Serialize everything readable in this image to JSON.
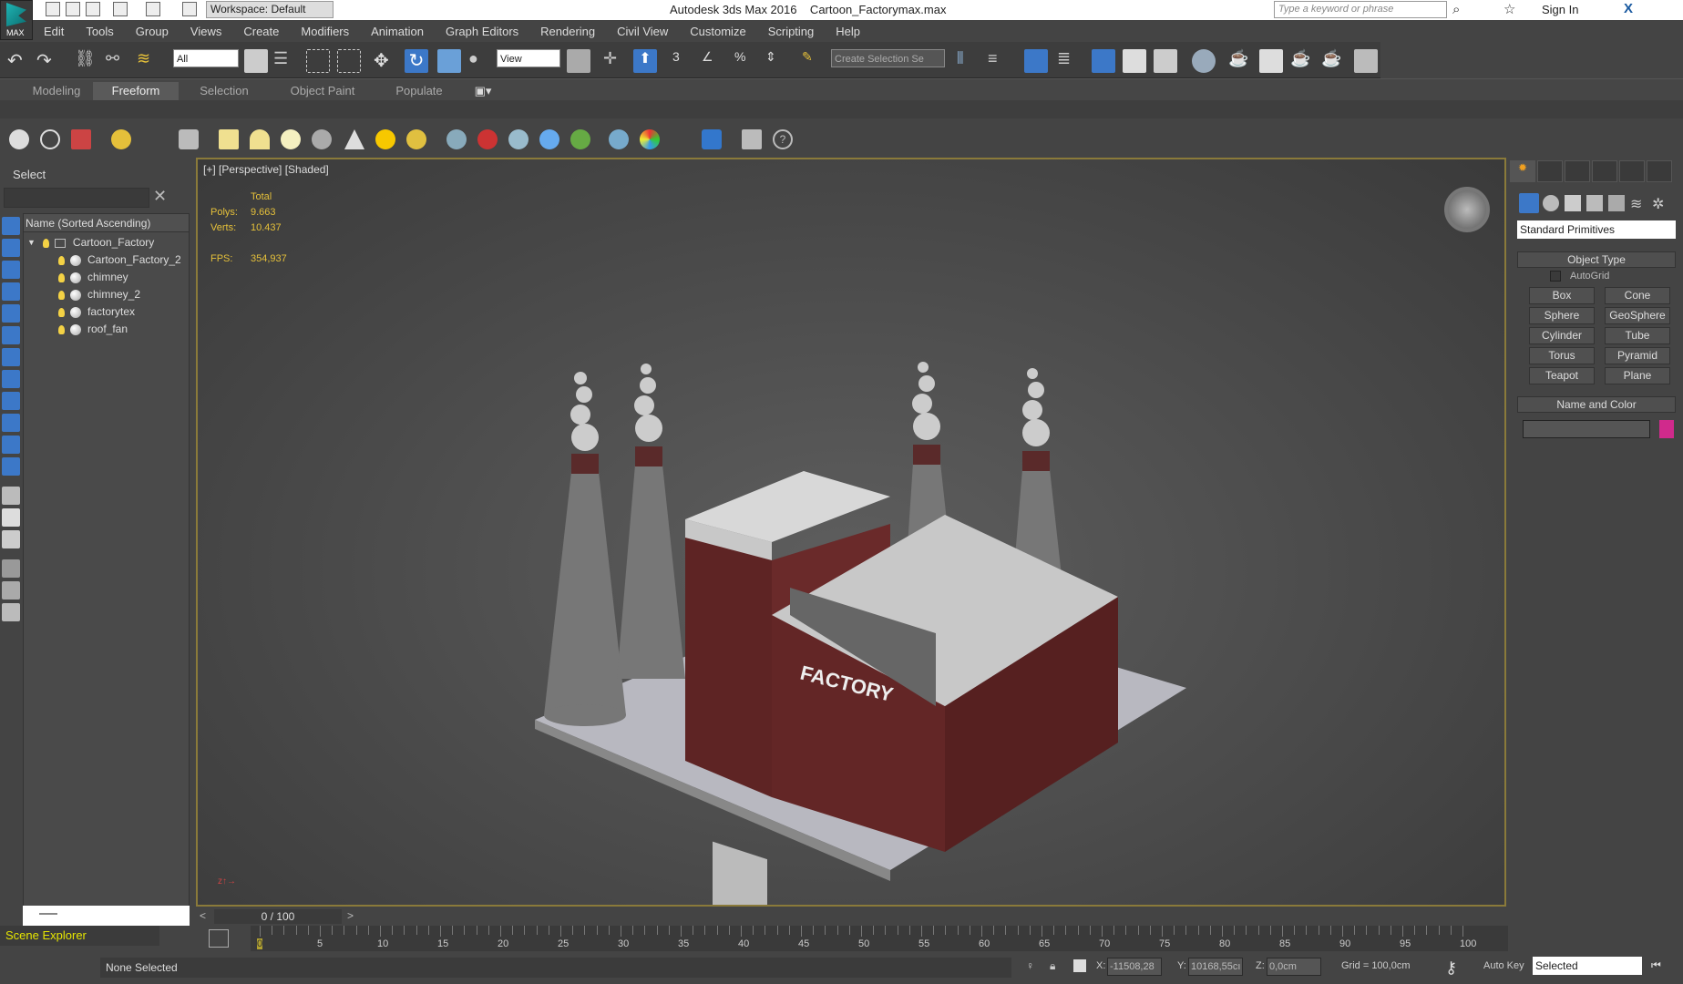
{
  "titlebar": {
    "logo": "MAX",
    "workspace": "Workspace: Default",
    "title": "Autodesk 3ds Max 2016    Cartoon_Factorymax.max",
    "search_placeholder": "Type a keyword or phrase",
    "sign_in": "Sign In"
  },
  "menu": [
    "Edit",
    "Tools",
    "Group",
    "Views",
    "Create",
    "Modifiers",
    "Animation",
    "Graph Editors",
    "Rendering",
    "Civil View",
    "Customize",
    "Scripting",
    "Help"
  ],
  "toolbar": {
    "selection_filter": "All",
    "ref_coord": "View",
    "named_selection": "Create Selection Se"
  },
  "ribbon": {
    "tabs": [
      "Modeling",
      "Freeform",
      "Selection",
      "Object Paint",
      "Populate"
    ],
    "active": "Freeform"
  },
  "scene_explorer": {
    "header": "Select",
    "column": "Name (Sorted Ascending)",
    "root": "Cartoon_Factory",
    "items": [
      "Cartoon_Factory_2",
      "chimney",
      "chimney_2",
      "factorytex",
      "roof_fan"
    ],
    "footer": "Scene Explorer"
  },
  "viewport": {
    "label": "[+] [Perspective] [Shaded]",
    "stats": {
      "total": "Total",
      "polys_label": "Polys:",
      "polys": "9.663",
      "verts_label": "Verts:",
      "verts": "10.437",
      "fps_label": "FPS:",
      "fps": "354,937"
    },
    "model_text": "FACTORY"
  },
  "command_panel": {
    "dropdown": "Standard Primitives",
    "object_type": "Object Type",
    "autogrid": "AutoGrid",
    "buttons": [
      "Box",
      "Cone",
      "Sphere",
      "GeoSphere",
      "Cylinder",
      "Tube",
      "Torus",
      "Pyramid",
      "Teapot",
      "Plane"
    ],
    "name_and_color": "Name and Color",
    "color": "#d02a8c"
  },
  "timeline": {
    "frame": "0 / 100",
    "ticks": [
      "0",
      "5",
      "10",
      "15",
      "20",
      "25",
      "30",
      "35",
      "40",
      "45",
      "50",
      "55",
      "60",
      "65",
      "70",
      "75",
      "80",
      "85",
      "90",
      "95",
      "100"
    ]
  },
  "status": {
    "selection": "None Selected",
    "x_label": "X:",
    "x": "-11508,28",
    "y_label": "Y:",
    "y": "10168,55cı",
    "z_label": "Z:",
    "z": "0,0cm",
    "grid": "Grid = 100,0cm",
    "auto_key": "Auto Key",
    "key_mode": "Selected"
  }
}
